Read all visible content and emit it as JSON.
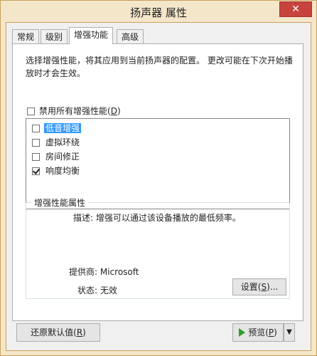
{
  "window": {
    "title": "扬声器 属性",
    "close_label": "✕"
  },
  "tabs": [
    {
      "label": "常规",
      "active": false
    },
    {
      "label": "级别",
      "active": false
    },
    {
      "label": "增强功能",
      "active": true
    },
    {
      "label": "高级",
      "active": false
    }
  ],
  "enhancements": {
    "description": "选择增强性能，将其应用到当前扬声器的配置。 更改可能在下次开始播放时才会生效。",
    "disable_all": {
      "label": "禁用所有增强性能(",
      "accel": "D",
      "suffix": ")",
      "checked": false
    },
    "items": [
      {
        "label": "低音增强",
        "checked": false,
        "selected": true
      },
      {
        "label": "虚拟环绕",
        "checked": false,
        "selected": false
      },
      {
        "label": "房间修正",
        "checked": false,
        "selected": false
      },
      {
        "label": "响度均衡",
        "checked": true,
        "selected": false
      }
    ]
  },
  "properties": {
    "group_title": "增强性能属性",
    "description": "描述: 增强可以通过该设备播放的最低频率。",
    "provider": "提供商: Microsoft",
    "status": "状态: 无效",
    "settings_label": "设置(",
    "settings_accel": "S",
    "settings_suffix": ")..."
  },
  "footer": {
    "restore_label": "还原默认值(",
    "restore_accel": "R",
    "restore_suffix": ")",
    "preview_label": "预览(",
    "preview_accel": "P",
    "preview_suffix": ")",
    "preview_dropdown": "▼"
  },
  "colors": {
    "accent_selection": "#3399ff",
    "window_frame": "#f4e6c9",
    "close_button": "#c7433e",
    "play_icon": "#2e9e2e"
  }
}
